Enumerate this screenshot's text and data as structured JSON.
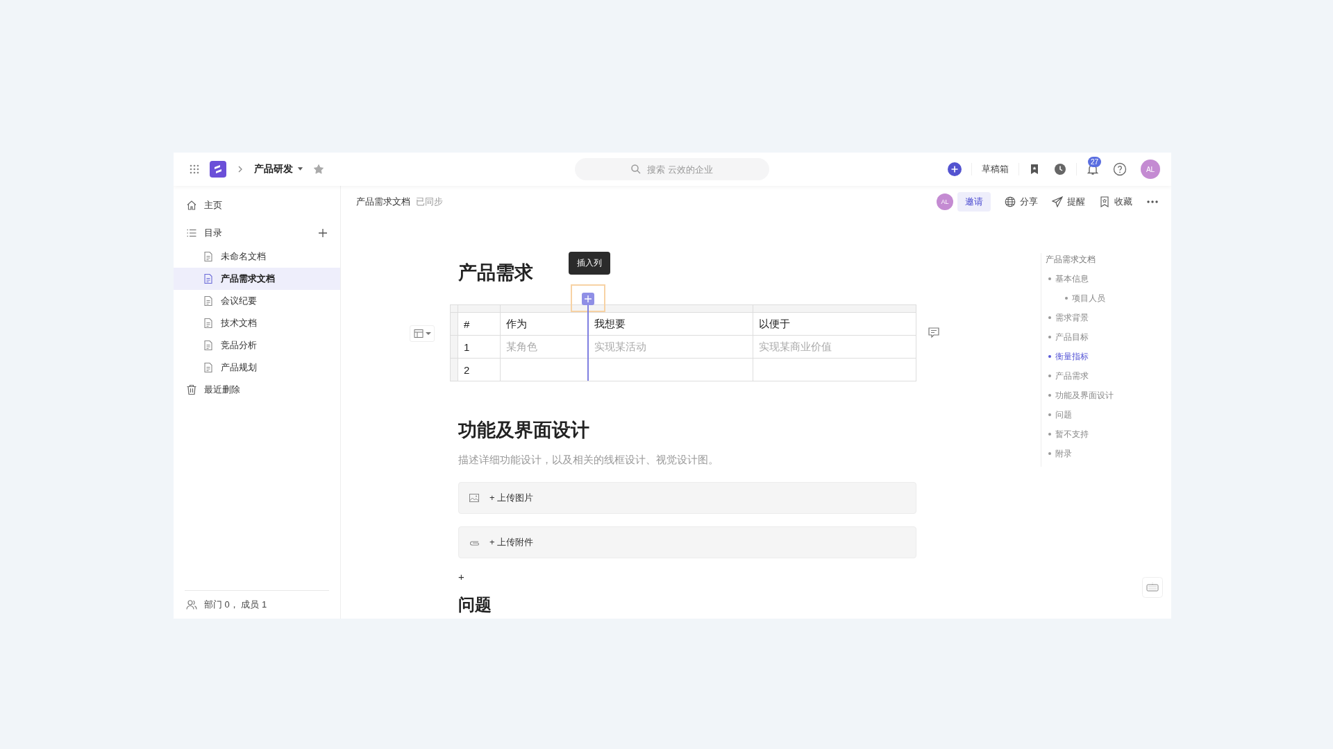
{
  "topbar": {
    "space": "产品研发",
    "starred": true,
    "search": {
      "placeholder": "搜索 云效的企业"
    },
    "drafts": "草稿箱",
    "notifications": "27",
    "avatar": "AL"
  },
  "sidebar": {
    "items": [
      {
        "kind": "home",
        "label": "主页",
        "selected": false
      },
      {
        "kind": "catalog",
        "label": "目录",
        "selected": false,
        "children": [
          {
            "label": "未命名文档",
            "selected": false
          },
          {
            "label": "产品需求文档",
            "selected": true
          },
          {
            "label": "会议纪要",
            "selected": false
          },
          {
            "label": "技术文档",
            "selected": false
          },
          {
            "label": "竞品分析",
            "selected": false
          },
          {
            "label": "产品规划",
            "selected": false
          }
        ]
      },
      {
        "kind": "trash",
        "label": "最近删除",
        "selected": false
      }
    ],
    "footer": "部门 0， 成员 1"
  },
  "doc_header": {
    "title": "产品需求文档",
    "status": "已同步",
    "avatar": "AL",
    "invite": "邀请",
    "actions": [
      {
        "kind": "share",
        "label": "分享"
      },
      {
        "kind": "remind",
        "label": "提醒"
      },
      {
        "kind": "favorite",
        "label": "收藏"
      }
    ]
  },
  "content": {
    "heading": "产品需求",
    "tooltip": "插入列",
    "table": {
      "columns": [
        "#",
        "作为",
        "我想要",
        "以便于"
      ],
      "rows": [
        {
          "cells": [
            "1",
            "某角色",
            "实现某活动",
            "实现某商业价值"
          ],
          "placeholder": true
        },
        {
          "cells": [
            "2"
          ]
        }
      ]
    },
    "heading_2": "功能及界面设计",
    "description": "描述详细功能设计，以及相关的线框设计、视觉设计图。",
    "uploads": [
      {
        "kind": "image",
        "label": "+ 上传图片"
      },
      {
        "kind": "file",
        "label": "+ 上传附件"
      }
    ],
    "add": "+",
    "heading_3": "问题"
  },
  "outline": {
    "title": "产品需求文档",
    "items": [
      {
        "label": "基本信息",
        "selected": false,
        "children": [
          {
            "label": "项目人员",
            "selected": false
          }
        ]
      },
      {
        "label": "需求背景",
        "selected": false
      },
      {
        "label": "产品目标",
        "selected": false
      },
      {
        "label": "衡量指标",
        "selected": true
      },
      {
        "label": "产品需求",
        "selected": false
      },
      {
        "label": "功能及界面设计",
        "selected": false
      },
      {
        "label": "问题",
        "selected": false
      },
      {
        "label": "暂不支持",
        "selected": false
      },
      {
        "label": "附录",
        "selected": false
      }
    ]
  }
}
